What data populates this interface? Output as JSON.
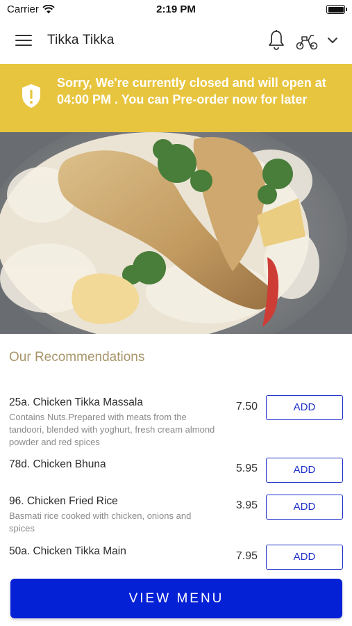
{
  "status_bar": {
    "carrier": "Carrier",
    "time": "2:19 PM"
  },
  "header": {
    "title": "Tikka Tikka"
  },
  "banner": {
    "message": "Sorry, We're currently closed and will open at 04:00 PM . You can Pre-order now for later",
    "color": "#e8c53f"
  },
  "recommendations": {
    "title": "Our Recommendations",
    "items": [
      {
        "name": "25a. Chicken Tikka Massala",
        "description": "Contains Nuts.Prepared with meats from the tandoori, blended with yoghurt, fresh cream almond powder and red spices",
        "price": "7.50",
        "button": "ADD"
      },
      {
        "name": "78d. Chicken Bhuna",
        "description": "",
        "price": "5.95",
        "button": "ADD"
      },
      {
        "name": "96. Chicken Fried Rice",
        "description": "Basmati rice cooked with chicken, onions and spices",
        "price": "3.95",
        "button": "ADD"
      },
      {
        "name": "50a. Chicken Tikka Main",
        "description": "",
        "price": "7.95",
        "button": "ADD"
      }
    ]
  },
  "view_menu": {
    "label": "VIEW MENU",
    "color": "#0521d6"
  },
  "icons": [
    "wifi-icon",
    "battery-icon",
    "menu-icon",
    "bell-icon",
    "scooter-icon",
    "chevron-down-icon",
    "shield-alert-icon"
  ]
}
